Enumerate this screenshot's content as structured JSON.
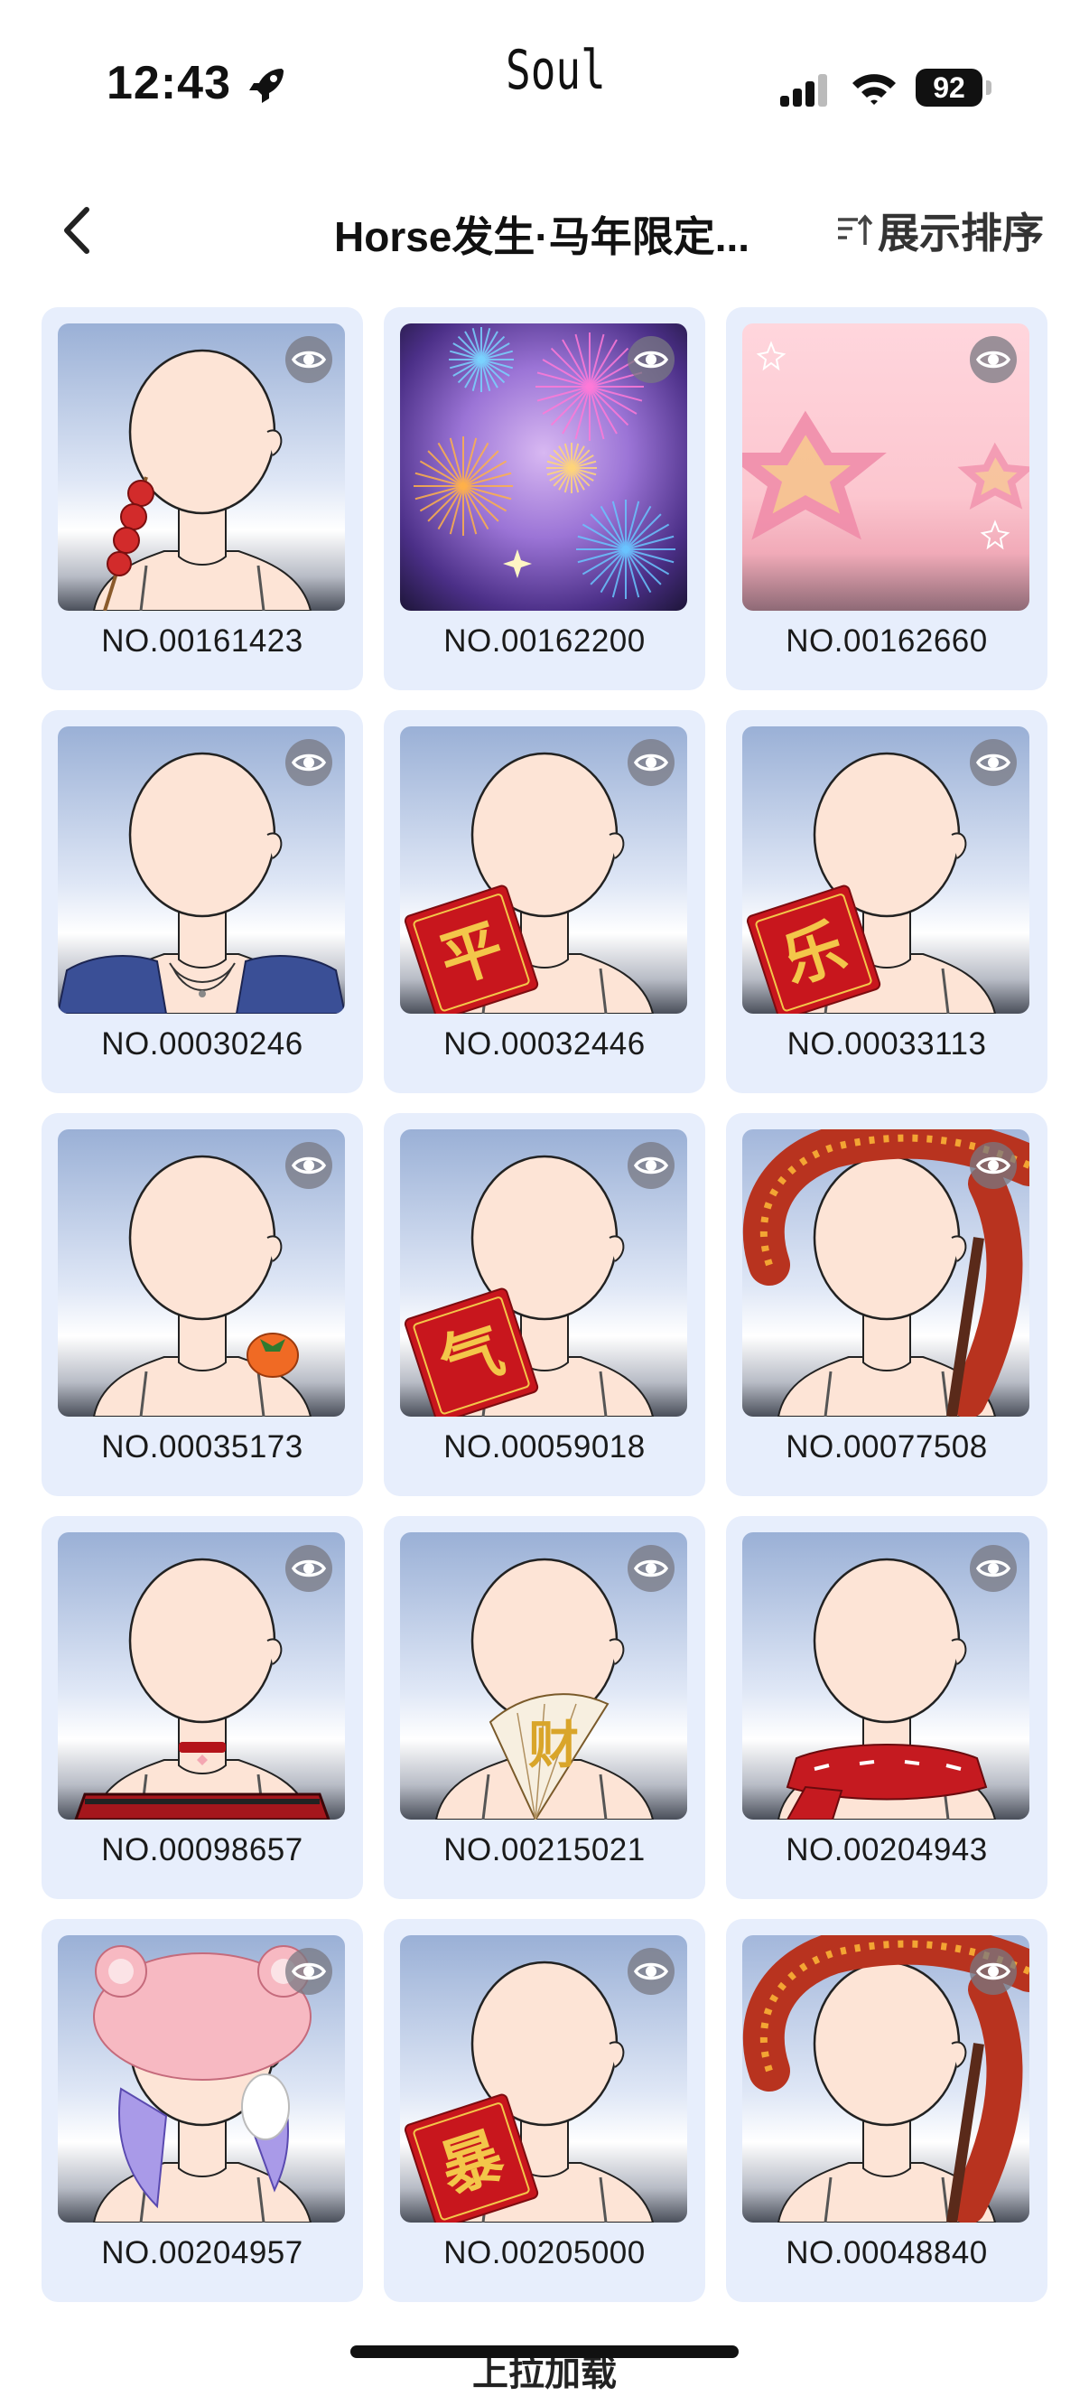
{
  "status_bar": {
    "time": "12:43",
    "app_name": "Soul",
    "battery": "92"
  },
  "header": {
    "title": "Horse发生·马年限定...",
    "sort_label": "展示排序"
  },
  "colors": {
    "card_bg": "#e7eefc",
    "accent_red": "#c8161d",
    "gold": "#f3c64a"
  },
  "items": [
    {
      "number": "NO.00161423",
      "art": "candied-haws"
    },
    {
      "number": "NO.00162200",
      "art": "fireworks"
    },
    {
      "number": "NO.00162660",
      "art": "pink-stars"
    },
    {
      "number": "NO.00030246",
      "art": "denim-jacket-necklace"
    },
    {
      "number": "NO.00032446",
      "art": "red-envelope",
      "glyph": "平"
    },
    {
      "number": "NO.00033113",
      "art": "red-envelope",
      "glyph": "乐"
    },
    {
      "number": "NO.00035173",
      "art": "persimmon"
    },
    {
      "number": "NO.00059018",
      "art": "red-envelope",
      "glyph": "气"
    },
    {
      "number": "NO.00077508",
      "art": "dragon"
    },
    {
      "number": "NO.00098657",
      "art": "choker-offshoulder"
    },
    {
      "number": "NO.00215021",
      "art": "folding-fan",
      "glyph": "财"
    },
    {
      "number": "NO.00204943",
      "art": "red-scarf"
    },
    {
      "number": "NO.00204957",
      "art": "sheep-hat"
    },
    {
      "number": "NO.00205000",
      "art": "red-envelope",
      "glyph": "暴"
    },
    {
      "number": "NO.00048840",
      "art": "dragon"
    }
  ],
  "footer": {
    "load_more": "上拉加载"
  }
}
